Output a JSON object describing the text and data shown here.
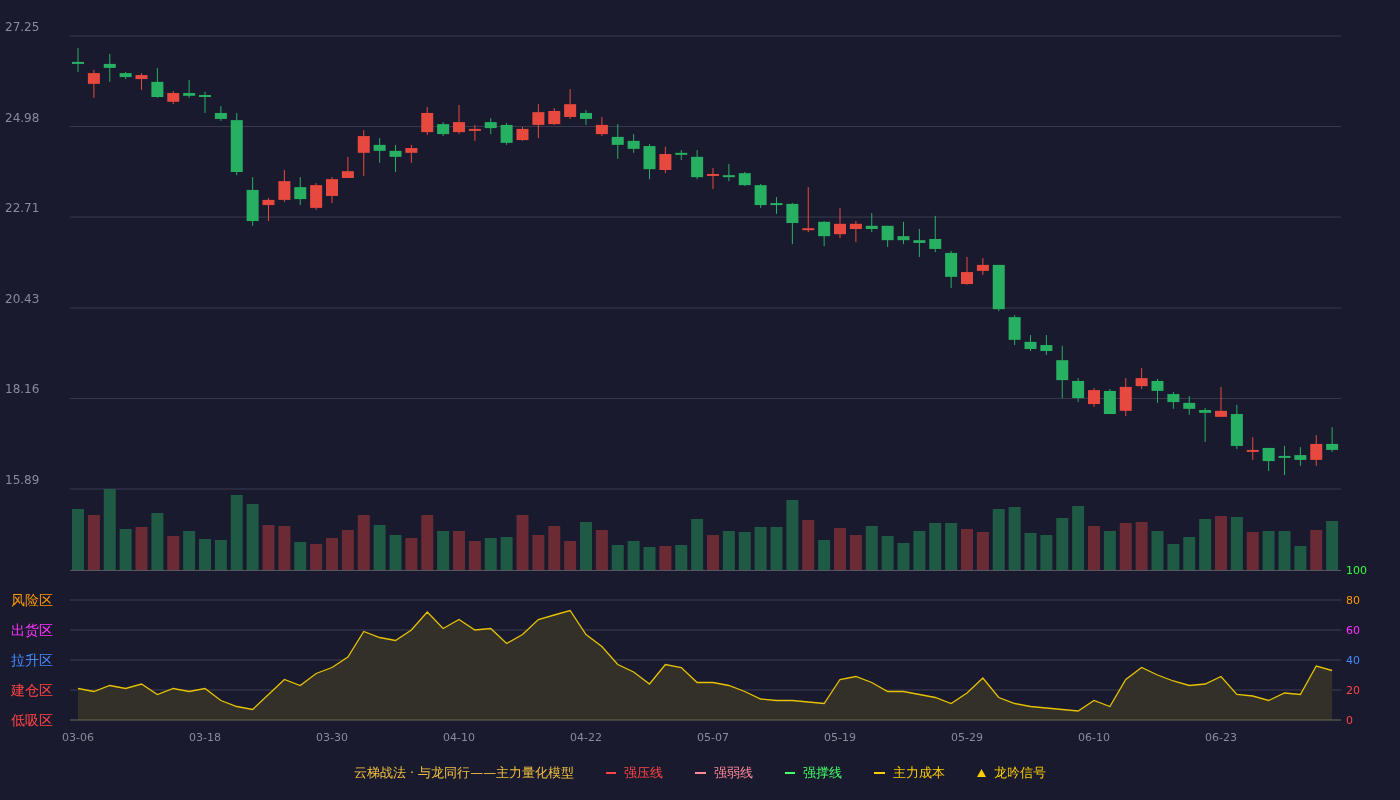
{
  "price_chart": {
    "chart_data": {
      "type": "candlestick",
      "grid": true,
      "ylim": [
        15.89,
        27.25
      ],
      "yticks": [
        27.25,
        24.98,
        22.71,
        20.43,
        18.16,
        15.89
      ],
      "ohlc": [
        [
          26.6,
          26.95,
          26.35,
          26.55
        ],
        [
          26.05,
          26.4,
          25.7,
          26.32
        ],
        [
          26.55,
          26.8,
          26.1,
          26.45
        ],
        [
          26.32,
          26.35,
          26.17,
          26.22
        ],
        [
          26.17,
          26.32,
          25.9,
          26.27
        ],
        [
          26.1,
          26.45,
          25.7,
          25.72
        ],
        [
          25.6,
          25.87,
          25.54,
          25.82
        ],
        [
          25.82,
          26.15,
          25.7,
          25.75
        ],
        [
          25.77,
          25.85,
          25.32,
          25.72
        ],
        [
          25.32,
          25.49,
          25.12,
          25.17
        ],
        [
          25.14,
          25.32,
          23.76,
          23.84
        ],
        [
          23.39,
          23.71,
          22.49,
          22.61
        ],
        [
          23.01,
          23.19,
          22.61,
          23.14
        ],
        [
          23.14,
          23.89,
          23.09,
          23.61
        ],
        [
          23.46,
          23.71,
          23.01,
          23.16
        ],
        [
          22.94,
          23.56,
          22.89,
          23.51
        ],
        [
          23.24,
          23.71,
          23.06,
          23.66
        ],
        [
          23.69,
          24.22,
          23.69,
          23.86
        ],
        [
          24.32,
          24.89,
          23.74,
          24.74
        ],
        [
          24.52,
          24.69,
          24.07,
          24.37
        ],
        [
          24.37,
          24.52,
          23.84,
          24.22
        ],
        [
          24.32,
          24.52,
          24.07,
          24.44
        ],
        [
          24.84,
          25.47,
          24.77,
          25.32
        ],
        [
          25.04,
          25.09,
          24.74,
          24.79
        ],
        [
          24.84,
          25.52,
          24.79,
          25.09
        ],
        [
          24.87,
          25.02,
          24.62,
          24.92
        ],
        [
          25.09,
          25.19,
          24.79,
          24.94
        ],
        [
          25.02,
          25.07,
          24.52,
          24.57
        ],
        [
          24.64,
          24.97,
          24.62,
          24.92
        ],
        [
          25.02,
          25.54,
          24.69,
          25.34
        ],
        [
          25.04,
          25.44,
          25.02,
          25.37
        ],
        [
          25.22,
          25.92,
          25.17,
          25.54
        ],
        [
          25.32,
          25.39,
          25.02,
          25.17
        ],
        [
          24.79,
          25.22,
          24.74,
          25.02
        ],
        [
          24.72,
          25.04,
          24.17,
          24.52
        ],
        [
          24.62,
          24.79,
          24.32,
          24.42
        ],
        [
          24.49,
          24.54,
          23.66,
          23.91
        ],
        [
          23.89,
          24.47,
          23.81,
          24.29
        ],
        [
          24.32,
          24.39,
          24.14,
          24.27
        ],
        [
          24.22,
          24.39,
          23.66,
          23.71
        ],
        [
          23.74,
          23.94,
          23.41,
          23.79
        ],
        [
          23.76,
          24.04,
          23.61,
          23.71
        ],
        [
          23.81,
          23.84,
          23.49,
          23.51
        ],
        [
          23.51,
          23.54,
          22.94,
          23.01
        ],
        [
          23.06,
          23.21,
          22.79,
          23.01
        ],
        [
          23.04,
          23.06,
          22.03,
          22.56
        ],
        [
          22.38,
          23.46,
          22.33,
          22.43
        ],
        [
          22.59,
          22.61,
          21.98,
          22.23
        ],
        [
          22.28,
          22.94,
          22.18,
          22.54
        ],
        [
          22.41,
          22.61,
          22.08,
          22.54
        ],
        [
          22.49,
          22.81,
          22.33,
          22.41
        ],
        [
          22.49,
          22.49,
          21.96,
          22.13
        ],
        [
          22.23,
          22.59,
          22.03,
          22.13
        ],
        [
          22.13,
          22.41,
          21.71,
          22.06
        ],
        [
          22.16,
          22.74,
          21.83,
          21.91
        ],
        [
          21.81,
          21.86,
          20.93,
          21.21
        ],
        [
          21.03,
          21.71,
          21.01,
          21.33
        ],
        [
          21.36,
          21.68,
          21.26,
          21.51
        ],
        [
          21.51,
          21.51,
          20.35,
          20.4
        ],
        [
          20.2,
          20.25,
          19.5,
          19.63
        ],
        [
          19.58,
          19.75,
          19.35,
          19.4
        ],
        [
          19.5,
          19.75,
          19.25,
          19.35
        ],
        [
          19.12,
          19.48,
          18.17,
          18.62
        ],
        [
          18.6,
          18.67,
          18.07,
          18.17
        ],
        [
          18.02,
          18.42,
          17.95,
          18.37
        ],
        [
          18.35,
          18.4,
          17.77,
          17.77
        ],
        [
          17.85,
          18.67,
          17.72,
          18.45
        ],
        [
          18.47,
          18.92,
          18.4,
          18.67
        ],
        [
          18.6,
          18.65,
          18.05,
          18.35
        ],
        [
          18.27,
          18.32,
          17.9,
          18.07
        ],
        [
          18.05,
          18.22,
          17.75,
          17.9
        ],
        [
          17.87,
          17.92,
          17.07,
          17.8
        ],
        [
          17.7,
          18.45,
          17.7,
          17.85
        ],
        [
          17.77,
          18.0,
          16.89,
          16.97
        ],
        [
          16.82,
          17.19,
          16.62,
          16.87
        ],
        [
          16.92,
          16.92,
          16.34,
          16.59
        ],
        [
          16.72,
          16.97,
          16.24,
          16.67
        ],
        [
          16.74,
          16.94,
          16.47,
          16.62
        ],
        [
          16.62,
          17.24,
          16.47,
          17.02
        ],
        [
          17.02,
          17.44,
          16.82,
          16.87
        ]
      ]
    }
  },
  "indicator": {
    "zone_labels": [
      {
        "text": "风险区",
        "color": "#ff9900"
      },
      {
        "text": "出货区",
        "color": "#ff33ff"
      },
      {
        "text": "拉升区",
        "color": "#4488ff"
      },
      {
        "text": "建仓区",
        "color": "#ff4444"
      },
      {
        "text": "低吸区",
        "color": "#ff4444"
      }
    ],
    "axis_label_styles": [
      {
        "color": "#33ff33"
      },
      {
        "color": "#ff9900"
      },
      {
        "color": "#ff33ff"
      },
      {
        "color": "#4488ff"
      },
      {
        "color": "#ff4444"
      },
      {
        "color": "#ff4444"
      }
    ],
    "chart_data": {
      "type": "area",
      "grid": true,
      "ylim": [
        0,
        100
      ],
      "yticks": [
        100,
        80,
        60,
        40,
        20,
        0
      ],
      "categories": [
        "03-06",
        null,
        null,
        null,
        null,
        null,
        null,
        null,
        "03-18",
        null,
        null,
        null,
        null,
        null,
        null,
        null,
        "03-30",
        null,
        null,
        null,
        null,
        null,
        null,
        null,
        "04-10",
        null,
        null,
        null,
        null,
        null,
        null,
        null,
        "04-22",
        null,
        null,
        null,
        null,
        null,
        null,
        null,
        "05-07",
        null,
        null,
        null,
        null,
        null,
        null,
        null,
        "05-19",
        null,
        null,
        null,
        null,
        null,
        null,
        null,
        "05-29",
        null,
        null,
        null,
        null,
        null,
        null,
        null,
        "06-10",
        null,
        null,
        null,
        null,
        null,
        null,
        null,
        "06-23",
        null,
        null,
        null,
        null,
        null,
        null,
        null
      ],
      "values": [
        21,
        19,
        23,
        21,
        24,
        17,
        21,
        19,
        21,
        13,
        9,
        7,
        17,
        27,
        23,
        31,
        35,
        42,
        59,
        55,
        53,
        60,
        72,
        61,
        67,
        60,
        61,
        51,
        57,
        67,
        70,
        73,
        57,
        49,
        37,
        32,
        24,
        37,
        35,
        25,
        25,
        23,
        19,
        14,
        13,
        13,
        12,
        11,
        27,
        29,
        25,
        19,
        19,
        17,
        15,
        11,
        18,
        28,
        15,
        11,
        9,
        8,
        7,
        6,
        13,
        9,
        27,
        35,
        30,
        26,
        23,
        24,
        29,
        17,
        16,
        13,
        18,
        17,
        36,
        33
      ]
    }
  },
  "legend": {
    "title": "云梯战法 · 与龙同行——主力量化模型",
    "items": [
      {
        "kind": "solid",
        "label": "强压线",
        "color": "#ff4444"
      },
      {
        "kind": "dashed",
        "label": "强弱线",
        "color": "#ff8899"
      },
      {
        "kind": "solid",
        "label": "强撑线",
        "color": "#44ff66"
      },
      {
        "kind": "dashed",
        "label": "主力成本",
        "color": "#ffcc00"
      },
      {
        "kind": "triangle",
        "label": "龙吟信号",
        "color": "#ffcc00"
      }
    ]
  }
}
